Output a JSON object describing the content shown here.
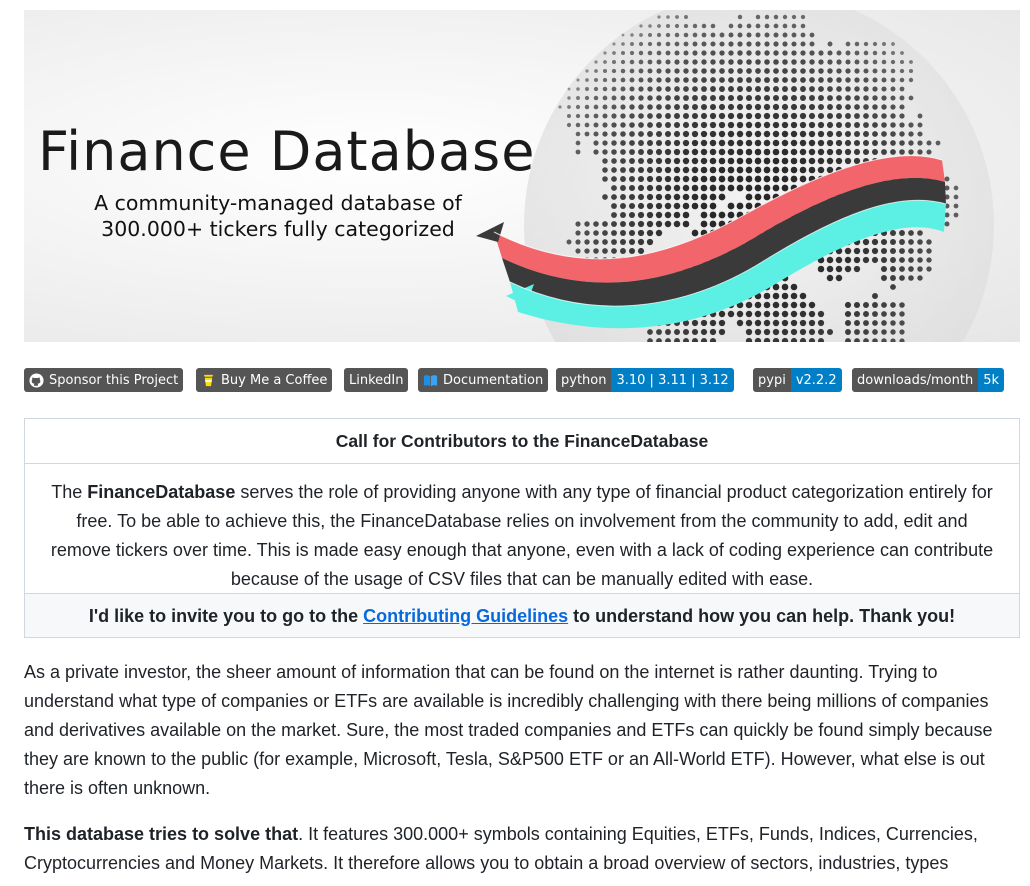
{
  "banner": {
    "title": "Finance Database",
    "subtitle": "A community-managed database of 300.000+ tickers fully categorized"
  },
  "badges": [
    {
      "icon": "github-icon",
      "left": "Sponsor this Project",
      "right": ""
    },
    {
      "icon": "coffee-cup-icon",
      "left": "Buy Me a Coffee",
      "right": ""
    },
    {
      "icon": "",
      "left": "LinkedIn",
      "right": ""
    },
    {
      "icon": "book-icon",
      "left": "Documentation",
      "right": ""
    },
    {
      "icon": "",
      "left": "python",
      "right": "3.10 | 3.11 | 3.12"
    },
    {
      "icon": "",
      "left": "pypi",
      "right": "v2.2.2"
    },
    {
      "icon": "",
      "left": "downloads/month",
      "right": "5k"
    }
  ],
  "contributors": {
    "header": "Call for Contributors to the FinanceDatabase",
    "body_prefix": "The ",
    "body_bold": "FinanceDatabase",
    "body_rest": " serves the role of providing anyone with any type of financial product categorization entirely for free. To be able to achieve this, the FinanceDatabase relies on involvement from the community to add, edit and remove tickers over time. This is made easy enough that anyone, even with a lack of coding experience can contribute because of the usage of CSV files that can be manually edited with ease.",
    "footer_prefix": "I'd like to invite you to go to the ",
    "footer_link": "Contributing Guidelines",
    "footer_suffix": " to understand how you can help. Thank you!"
  },
  "paragraphs": {
    "p1": "As a private investor, the sheer amount of information that can be found on the internet is rather daunting. Trying to understand what type of companies or ETFs are available is incredibly challenging with there being millions of companies and derivatives available on the market. Sure, the most traded companies and ETFs can quickly be found simply because they are known to the public (for example, Microsoft, Tesla, S&P500 ETF or an All-World ETF). However, what else is out there is often unknown.",
    "p2_bold": "This database tries to solve that",
    "p2_rest": ". It features 300.000+ symbols containing Equities, ETFs, Funds, Indices, Currencies, Cryptocurrencies and Money Markets. It therefore allows you to obtain a broad overview of sectors, industries, types"
  },
  "colors": {
    "badge_left": "#555555",
    "badge_right": "#007ec6",
    "link": "#0969da",
    "swoosh_red": "#f2656a",
    "swoosh_dark": "#3a3a3a",
    "swoosh_cyan": "#5cf0e4"
  }
}
